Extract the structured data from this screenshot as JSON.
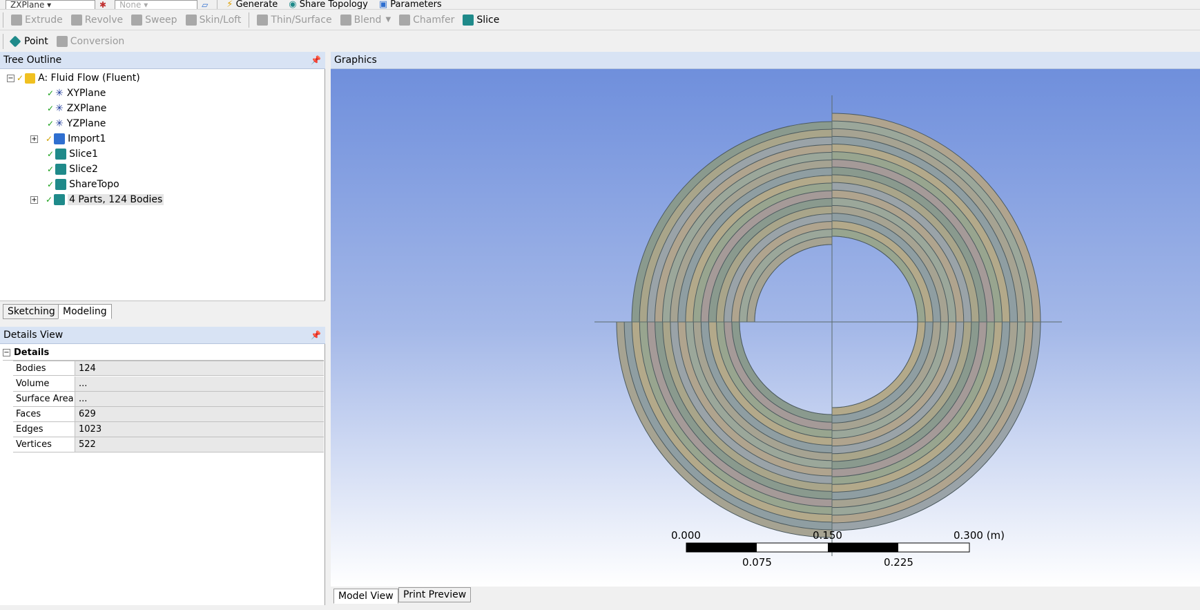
{
  "toolbar_top": {
    "plane_select": "ZXPlane",
    "none_select": "None",
    "generate_label": "Generate",
    "share_topology_label": "Share Topology",
    "parameters_label": "Parameters"
  },
  "toolbar_features": {
    "items": [
      "Extrude",
      "Revolve",
      "Sweep",
      "Skin/Loft",
      "Thin/Surface",
      "Blend",
      "Chamfer",
      "Slice"
    ]
  },
  "toolbar_tools": {
    "point_label": "Point",
    "conversion_label": "Conversion"
  },
  "tree_outline": {
    "title": "Tree Outline",
    "pin": "ᵖ",
    "root": "A: Fluid Flow (Fluent)",
    "items": [
      "XYPlane",
      "ZXPlane",
      "YZPlane",
      "Import1",
      "Slice1",
      "Slice2",
      "ShareTopo",
      "4 Parts, 124 Bodies"
    ]
  },
  "mode_tabs": {
    "sketching": "Sketching",
    "modeling": "Modeling"
  },
  "details_view": {
    "title": "Details View",
    "pin": "ᵖ",
    "group": "Details",
    "rows": [
      {
        "key": "Bodies",
        "value": "124"
      },
      {
        "key": "Volume",
        "value": "..."
      },
      {
        "key": "Surface Area",
        "value": "..."
      },
      {
        "key": "Faces",
        "value": "629"
      },
      {
        "key": "Edges",
        "value": "1023"
      },
      {
        "key": "Vertices",
        "value": "522"
      }
    ]
  },
  "graphics": {
    "title": "Graphics",
    "scale": {
      "top_labels": [
        "0.000",
        "0.150",
        "0.300 (m)"
      ],
      "bottom_labels": [
        "0.075",
        "0.225"
      ]
    },
    "ring_colors": [
      "#8a9a8e",
      "#a9a58a",
      "#9aa3a8",
      "#b0a48e",
      "#9ba79a",
      "#a6a392",
      "#8f9ea2",
      "#b3a98a",
      "#98a58f",
      "#a59a98"
    ]
  },
  "view_tabs": {
    "model_view": "Model View",
    "print_preview": "Print Preview"
  }
}
